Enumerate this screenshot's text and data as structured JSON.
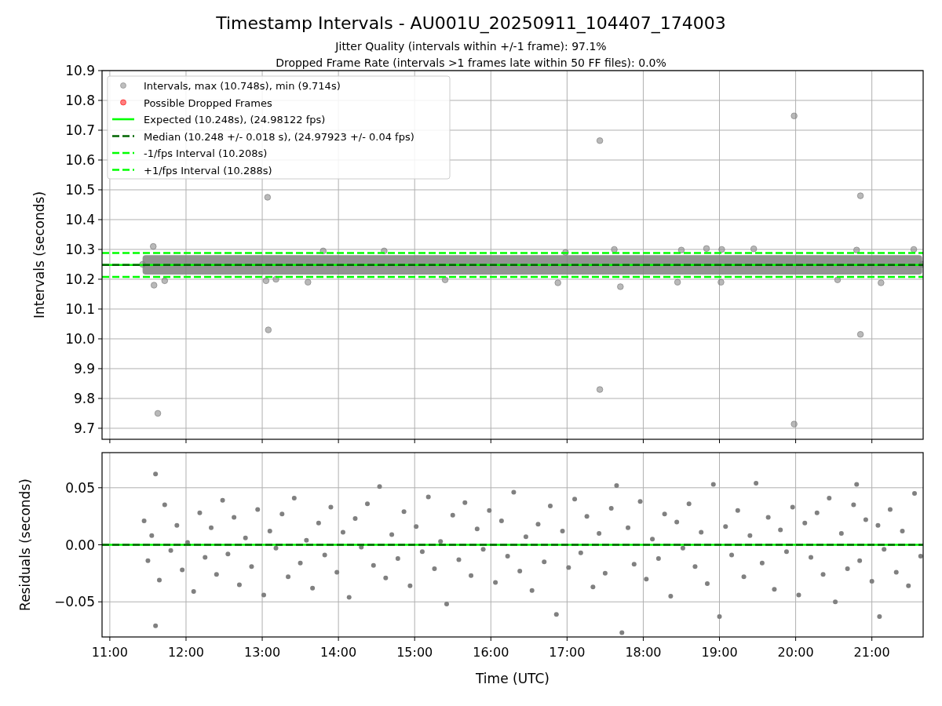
{
  "figure": {
    "title": "Timestamp Intervals - AU001U_20250911_104407_174003",
    "subtitles": [
      "Jitter Quality (intervals within +/-1 frame): 97.1%",
      "Dropped Frame Rate (intervals >1 frames late within 50 FF files): 0.0%"
    ]
  },
  "charts": [
    {
      "chart_data": {
        "type": "scatter",
        "legend": "upper left",
        "ylabel": "Intervals (seconds)",
        "xlim": [
          10.898,
          21.673
        ],
        "ylim": [
          9.663,
          10.9
        ],
        "grid": true,
        "yticks": [
          {
            "value": 9.7,
            "label": "9.7"
          },
          {
            "value": 9.8,
            "label": "9.8"
          },
          {
            "value": 9.9,
            "label": "9.9"
          },
          {
            "value": 10.0,
            "label": "10.0"
          },
          {
            "value": 10.1,
            "label": "10.1"
          },
          {
            "value": 10.2,
            "label": "10.2"
          },
          {
            "value": 10.3,
            "label": "10.3"
          },
          {
            "value": 10.4,
            "label": "10.4"
          },
          {
            "value": 10.5,
            "label": "10.5"
          },
          {
            "value": 10.6,
            "label": "10.6"
          },
          {
            "value": 10.7,
            "label": "10.7"
          },
          {
            "value": 10.8,
            "label": "10.8"
          },
          {
            "value": 10.9,
            "label": "10.9"
          }
        ],
        "series": [
          {
            "name": "Intervals, max (10.748s), min (9.714s)",
            "color": "#808080",
            "x": [
              11.43,
              11.57,
              11.58,
              11.63,
              11.72,
              13.05,
              13.07,
              13.08,
              13.18,
              13.6,
              13.8,
              14.6,
              15.4,
              16.88,
              16.98,
              17.43,
              17.43,
              17.62,
              17.7,
              18.45,
              18.5,
              18.83,
              19.03,
              19.02,
              19.45,
              19.98,
              19.98,
              20.55,
              20.8,
              20.85,
              20.85,
              21.12,
              21.55,
              21.66
            ],
            "values": [
              10.25,
              10.31,
              10.18,
              9.75,
              10.195,
              10.195,
              10.475,
              10.03,
              10.2,
              10.19,
              10.295,
              10.295,
              10.198,
              10.188,
              10.29,
              10.665,
              9.83,
              10.3,
              10.175,
              10.19,
              10.298,
              10.303,
              10.3,
              10.19,
              10.302,
              10.748,
              9.714,
              10.198,
              10.298,
              10.48,
              10.015,
              10.188,
              10.3,
              10.25
            ]
          },
          {
            "name": "Possible Dropped Frames",
            "color": "#ff0000"
          }
        ],
        "bands": [
          {
            "axis": "y",
            "from": 10.216,
            "to": 10.281,
            "color": "#808080"
          }
        ],
        "ref_lines": [
          {
            "axis": "y",
            "value": 10.248,
            "label": "Expected (10.248s), (24.98122 fps)",
            "color": "#00ff00"
          },
          {
            "axis": "y",
            "value": 10.248,
            "label": "Median (10.248 +/- 0.018 s), (24.97923 +/- 0.04 fps)",
            "color": "#006400"
          },
          {
            "axis": "y",
            "value": 10.208,
            "label": "-1/fps Interval (10.208s)",
            "color": "#00ff00"
          },
          {
            "axis": "y",
            "value": 10.288,
            "label": "+1/fps Interval (10.288s)",
            "color": "#00ff00"
          }
        ]
      }
    },
    {
      "chart_data": {
        "type": "scatter",
        "grid": true,
        "xlabel": "Time (UTC)",
        "ylabel": "Residuals (seconds)",
        "xlim": [
          10.898,
          21.673
        ],
        "ylim": [
          -0.0808,
          0.0808
        ],
        "xticks": [
          {
            "value": 11,
            "label": "11:00"
          },
          {
            "value": 12,
            "label": "12:00"
          },
          {
            "value": 13,
            "label": "13:00"
          },
          {
            "value": 14,
            "label": "14:00"
          },
          {
            "value": 15,
            "label": "15:00"
          },
          {
            "value": 16,
            "label": "16:00"
          },
          {
            "value": 17,
            "label": "17:00"
          },
          {
            "value": 18,
            "label": "18:00"
          },
          {
            "value": 19,
            "label": "19:00"
          },
          {
            "value": 20,
            "label": "20:00"
          },
          {
            "value": 21,
            "label": "21:00"
          }
        ],
        "yticks": [
          {
            "value": -0.05,
            "label": "−0.05"
          },
          {
            "value": 0,
            "label": "0.00"
          },
          {
            "value": 0.05,
            "label": "0.05"
          }
        ],
        "series": [
          {
            "color": "#808080",
            "x": [
              11.45,
              11.5,
              11.55,
              11.6,
              11.6,
              11.65,
              11.72,
              11.8,
              11.88,
              11.95,
              12.02,
              12.1,
              12.18,
              12.25,
              12.33,
              12.4,
              12.48,
              12.55,
              12.63,
              12.7,
              12.78,
              12.86,
              12.94,
              13.02,
              13.1,
              13.18,
              13.26,
              13.34,
              13.42,
              13.5,
              13.58,
              13.66,
              13.74,
              13.82,
              13.9,
              13.98,
              14.06,
              14.14,
              14.22,
              14.3,
              14.38,
              14.46,
              14.54,
              14.62,
              14.7,
              14.78,
              14.86,
              14.94,
              15.02,
              15.1,
              15.18,
              15.26,
              15.34,
              15.42,
              15.5,
              15.58,
              15.66,
              15.74,
              15.82,
              15.9,
              15.98,
              16.06,
              16.14,
              16.22,
              16.3,
              16.38,
              16.46,
              16.54,
              16.62,
              16.7,
              16.78,
              16.86,
              16.94,
              17.02,
              17.1,
              17.18,
              17.26,
              17.34,
              17.42,
              17.5,
              17.58,
              17.65,
              17.72,
              17.8,
              17.88,
              17.96,
              18.04,
              18.12,
              18.2,
              18.28,
              18.36,
              18.44,
              18.52,
              18.6,
              18.68,
              18.76,
              18.84,
              18.92,
              19.0,
              19.08,
              19.16,
              19.24,
              19.32,
              19.4,
              19.48,
              19.56,
              19.64,
              19.72,
              19.8,
              19.88,
              19.96,
              20.04,
              20.12,
              20.2,
              20.28,
              20.36,
              20.44,
              20.52,
              20.6,
              20.68,
              20.76,
              20.8,
              20.84,
              20.92,
              21.0,
              21.08,
              21.1,
              21.16,
              21.24,
              21.32,
              21.4,
              21.48,
              21.56,
              21.64
            ],
            "values": [
              0.021,
              -0.014,
              0.008,
              0.062,
              -0.071,
              -0.031,
              0.035,
              -0.005,
              0.017,
              -0.022,
              0.002,
              -0.041,
              0.028,
              -0.011,
              0.015,
              -0.026,
              0.039,
              -0.008,
              0.024,
              -0.035,
              0.006,
              -0.019,
              0.031,
              -0.044,
              0.012,
              -0.003,
              0.027,
              -0.028,
              0.041,
              -0.016,
              0.004,
              -0.038,
              0.019,
              -0.009,
              0.033,
              -0.024,
              0.011,
              -0.046,
              0.023,
              -0.002,
              0.036,
              -0.018,
              0.051,
              -0.029,
              0.009,
              -0.012,
              0.029,
              -0.036,
              0.016,
              -0.006,
              0.042,
              -0.021,
              0.003,
              -0.052,
              0.026,
              -0.013,
              0.037,
              -0.027,
              0.014,
              -0.004,
              0.03,
              -0.033,
              0.021,
              -0.01,
              0.046,
              -0.023,
              0.007,
              -0.04,
              0.018,
              -0.015,
              0.034,
              -0.061,
              0.012,
              -0.02,
              0.04,
              -0.007,
              0.025,
              -0.037,
              0.01,
              -0.025,
              0.032,
              0.052,
              -0.077,
              0.015,
              -0.017,
              0.038,
              -0.03,
              0.005,
              -0.012,
              0.027,
              -0.045,
              0.02,
              -0.003,
              0.036,
              -0.019,
              0.011,
              -0.034,
              0.053,
              -0.063,
              0.016,
              -0.009,
              0.03,
              -0.028,
              0.008,
              0.054,
              -0.016,
              0.024,
              -0.039,
              0.013,
              -0.006,
              0.033,
              -0.044,
              0.019,
              -0.011,
              0.028,
              -0.026,
              0.041,
              -0.05,
              0.01,
              -0.021,
              0.035,
              0.053,
              -0.014,
              0.022,
              -0.032,
              0.017,
              -0.063,
              -0.004,
              0.031,
              -0.024,
              0.012,
              -0.036,
              0.045,
              -0.01
            ]
          }
        ],
        "ref_lines": [
          {
            "axis": "y",
            "value": 0,
            "color": "#00ff00"
          },
          {
            "axis": "y",
            "value": 0,
            "color": "#006400"
          }
        ]
      }
    }
  ]
}
